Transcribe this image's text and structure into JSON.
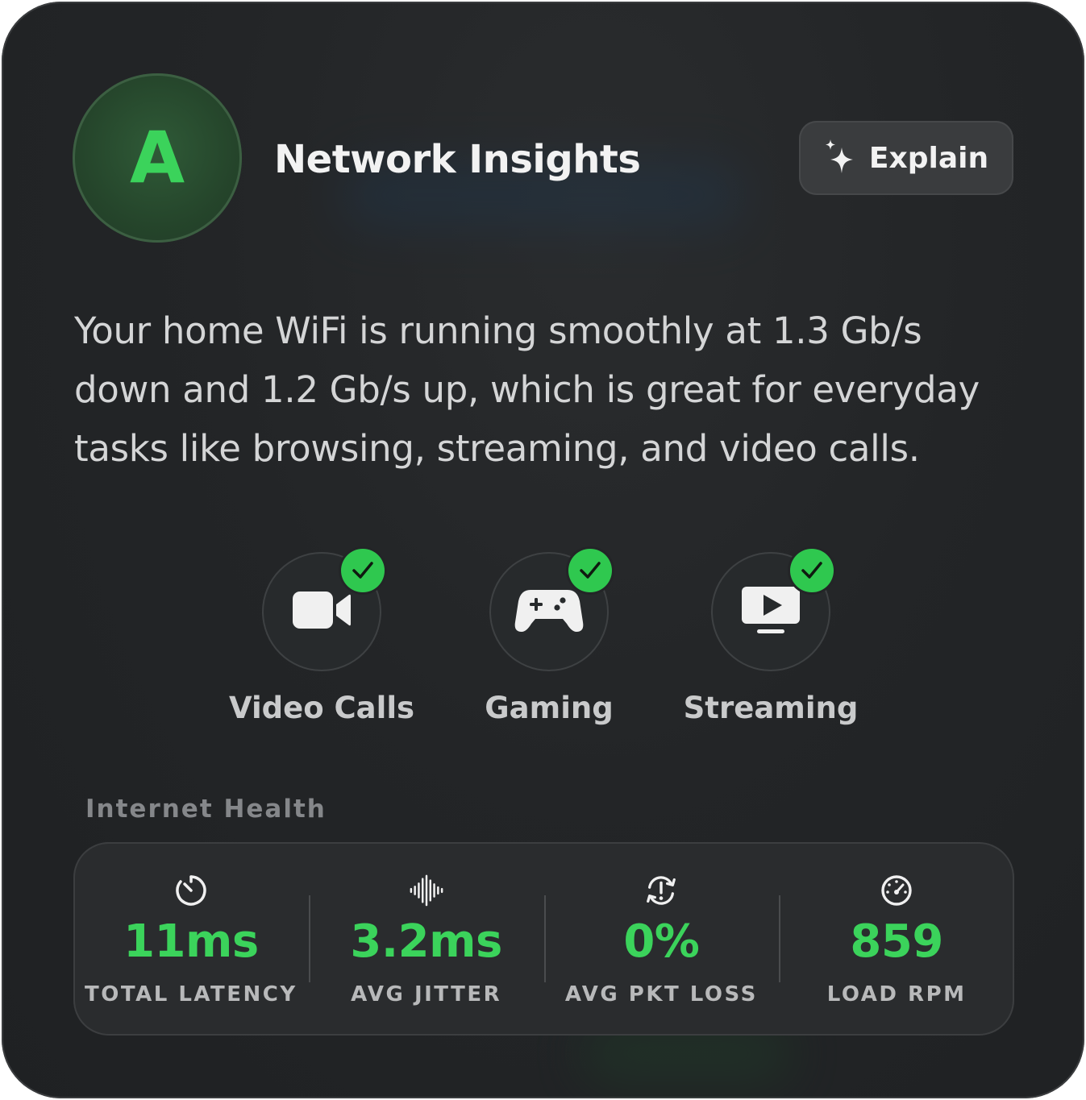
{
  "header": {
    "grade": "A",
    "title": "Network Insights",
    "explain_label": "Explain",
    "explain_icon": "sparkles-icon"
  },
  "summary": "Your home WiFi is running smoothly at 1.3 Gb/s down and 1.2 Gb/s up, which is great for everyday tasks like browsing, streaming, and video calls.",
  "activities": [
    {
      "label": "Video Calls",
      "icon": "video-camera-icon",
      "status": "ok"
    },
    {
      "label": "Gaming",
      "icon": "game-controller-icon",
      "status": "ok"
    },
    {
      "label": "Streaming",
      "icon": "tv-play-icon",
      "status": "ok"
    }
  ],
  "internet_health": {
    "title": "Internet Health",
    "metrics": [
      {
        "value": "11ms",
        "label": "TOTAL LATENCY",
        "icon": "timer-icon"
      },
      {
        "value": "3.2ms",
        "label": "AVG JITTER",
        "icon": "waveform-icon"
      },
      {
        "value": "0%",
        "label": "AVG PKT LOSS",
        "icon": "packet-loss-icon"
      },
      {
        "value": "859",
        "label": "LOAD RPM",
        "icon": "gauge-icon"
      }
    ]
  },
  "colors": {
    "accent_green": "#3bd35b",
    "check_green": "#2fc84f",
    "panel_background": "#232527"
  }
}
